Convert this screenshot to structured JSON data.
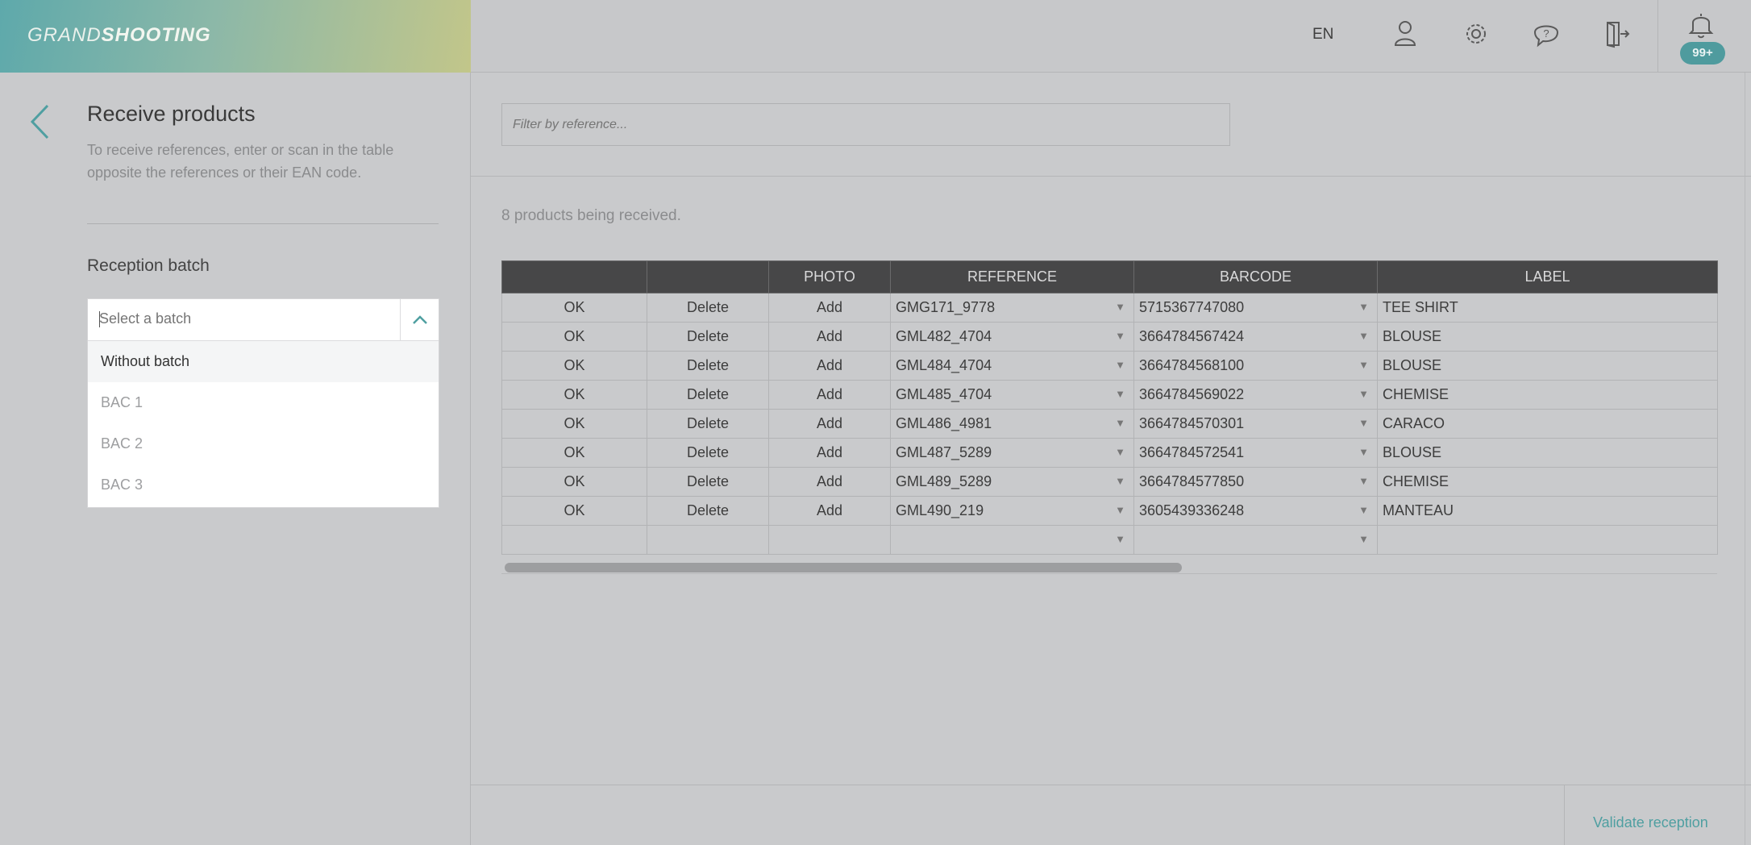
{
  "brand": {
    "logo_light": "GRAND",
    "logo_bold": "SHOOTING",
    "accent": "#4f9fa1"
  },
  "header": {
    "language": "EN",
    "icons": [
      "user-icon",
      "gear-icon",
      "help-icon",
      "logout-icon",
      "bell-icon"
    ],
    "notification_badge": "99+"
  },
  "panel": {
    "title": "Receive products",
    "description": "To receive references, enter or scan in the table opposite the references or their EAN code.",
    "batch_label": "Reception batch",
    "batch_placeholder": "Select a batch",
    "batch_options": [
      "Without batch",
      "BAC 1",
      "BAC 2",
      "BAC 3"
    ]
  },
  "main": {
    "filter_placeholder": "Filter by reference...",
    "count_text": "8 products being received.",
    "columns": [
      "",
      "",
      "PHOTO",
      "REFERENCE",
      "BARCODE",
      "LABEL"
    ],
    "rows": [
      {
        "status": "OK",
        "delete": "Delete",
        "photo": "Add",
        "reference": "GMG171_9778",
        "barcode": "5715367747080",
        "label": "TEE SHIRT"
      },
      {
        "status": "OK",
        "delete": "Delete",
        "photo": "Add",
        "reference": "GML482_4704",
        "barcode": "3664784567424",
        "label": "BLOUSE"
      },
      {
        "status": "OK",
        "delete": "Delete",
        "photo": "Add",
        "reference": "GML484_4704",
        "barcode": "3664784568100",
        "label": "BLOUSE"
      },
      {
        "status": "OK",
        "delete": "Delete",
        "photo": "Add",
        "reference": "GML485_4704",
        "barcode": "3664784569022",
        "label": "CHEMISE"
      },
      {
        "status": "OK",
        "delete": "Delete",
        "photo": "Add",
        "reference": "GML486_4981",
        "barcode": "3664784570301",
        "label": "CARACO"
      },
      {
        "status": "OK",
        "delete": "Delete",
        "photo": "Add",
        "reference": "GML487_5289",
        "barcode": "3664784572541",
        "label": "BLOUSE"
      },
      {
        "status": "OK",
        "delete": "Delete",
        "photo": "Add",
        "reference": "GML489_5289",
        "barcode": "3664784577850",
        "label": "CHEMISE"
      },
      {
        "status": "OK",
        "delete": "Delete",
        "photo": "Add",
        "reference": "GML490_219",
        "barcode": "3605439336248",
        "label": "MANTEAU"
      }
    ],
    "validate_label": "Validate reception"
  }
}
